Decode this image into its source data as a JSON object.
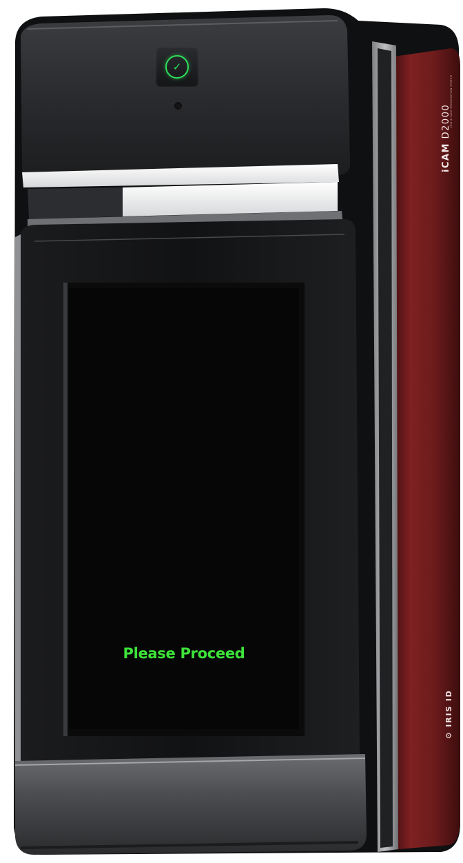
{
  "device": {
    "model_prefix": "iCAM",
    "model_number": "D2000",
    "subtitle": "IRIS & FACE RECOGNITION SYSTEM",
    "brand": "⚙ IRIS ID",
    "status_icon": "check-circle-icon",
    "status_color": "#2fe05a",
    "accent_color": "#7a1e1f"
  },
  "screen": {
    "status_message": "Please Proceed",
    "message_color": "#3ee23a",
    "face_photo": "face-photo",
    "eye_photos": [
      "left-eye-photo",
      "right-eye-photo"
    ]
  }
}
